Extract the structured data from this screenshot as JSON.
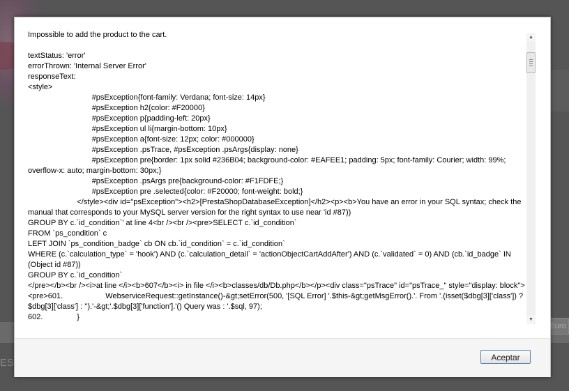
{
  "background": {
    "currency_label": "Euro",
    "side_text": "ES"
  },
  "dialog": {
    "lines": [
      "Impossible to add the product to the cart.",
      "",
      "textStatus: 'error'",
      "errorThrown: 'Internal Server Error'",
      "responseText:",
      "<style>",
      "                              #psException{font-family: Verdana; font-size: 14px}",
      "                              #psException h2{color: #F20000}",
      "                              #psException p{padding-left: 20px}",
      "                              #psException ul li{margin-bottom: 10px}",
      "                              #psException a{font-size: 12px; color: #000000}",
      "                              #psException .psTrace, #psException .psArgs{display: none}",
      "                              #psException pre{border: 1px solid #236B04; background-color: #EAFEE1; padding: 5px; font-family: Courier; width: 99%; overflow-x: auto; margin-bottom: 30px;}",
      "                              #psException .psArgs pre{background-color: #F1FDFE;}",
      "                              #psException pre .selected{color: #F20000; font-weight: bold;}",
      "                       </style><div id=\"psException\"><h2>[PrestaShopDatabaseException]</h2><p><b>You have an error in your SQL syntax; check the manual that corresponds to your MySQL server version for the right syntax to use near 'id #87))",
      "GROUP BY c.`id_condition`' at line 4<br /><br /><pre>SELECT c.`id_condition`",
      "FROM `ps_condition` c",
      "LEFT JOIN `ps_condition_badge` cb ON cb.`id_condition` = c.`id_condition`",
      "WHERE (c.`calculation_type` = 'hook') AND (c.`calculation_detail` = 'actionObjectCartAddAfter') AND (c.`validated` = 0) AND (cb.`id_badge` IN (Object id #87))",
      "GROUP BY c.`id_condition`",
      "</pre></b><br /><i>at line </i><b>607</b><i> in file </i><b>classes/db/Db.php</b></p><div class=\"psTrace\" id=\"psTrace_\" style=\"display: block\"><pre>601.                    WebserviceRequest::getInstance()-&gt;setError(500, '[SQL Error] '.$this-&gt;getMsgError().'. From '.(isset($dbg[3]['class']) ? $dbg[3]['class'] : '').'-&gt;'.$dbg[3]['function'].'() Query was : '.$sql, 97);",
      "602.                }"
    ],
    "ok_label": "Aceptar"
  }
}
